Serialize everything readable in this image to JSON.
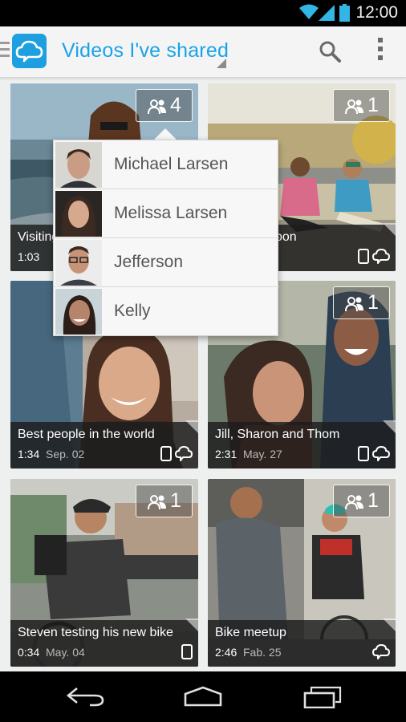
{
  "status_bar": {
    "time": "12:00"
  },
  "action_bar": {
    "title": "Videos I've shared"
  },
  "cards": [
    {
      "title": "Visiting",
      "duration": "1:03",
      "date": "",
      "share_count": "4"
    },
    {
      "title": "oon",
      "duration": "",
      "date": "",
      "share_count": "1"
    },
    {
      "title": "Best people in the world",
      "duration": "1:34",
      "date": "Sep. 02",
      "share_count": ""
    },
    {
      "title": "Jill, Sharon and Thom",
      "duration": "2:31",
      "date": "May. 27",
      "share_count": "1"
    },
    {
      "title": "Steven testing his new bike",
      "duration": "0:34",
      "date": "May. 04",
      "share_count": "1"
    },
    {
      "title": "Bike meetup",
      "duration": "2:46",
      "date": "Fab. 25",
      "share_count": "1"
    }
  ],
  "share_popup": {
    "people": [
      {
        "name": "Michael Larsen"
      },
      {
        "name": "Melissa Larsen"
      },
      {
        "name": "Jefferson"
      },
      {
        "name": "Kelly"
      }
    ]
  },
  "colors": {
    "accent": "#1aa3e8",
    "logo": "#1e9fe0"
  },
  "icons": [
    "wifi-icon",
    "signal-icon",
    "battery-icon",
    "cloud-logo-icon",
    "search-icon",
    "overflow-menu-icon",
    "people-icon",
    "phone-icon",
    "cloud-sync-icon",
    "back-icon",
    "home-icon",
    "recents-icon"
  ]
}
